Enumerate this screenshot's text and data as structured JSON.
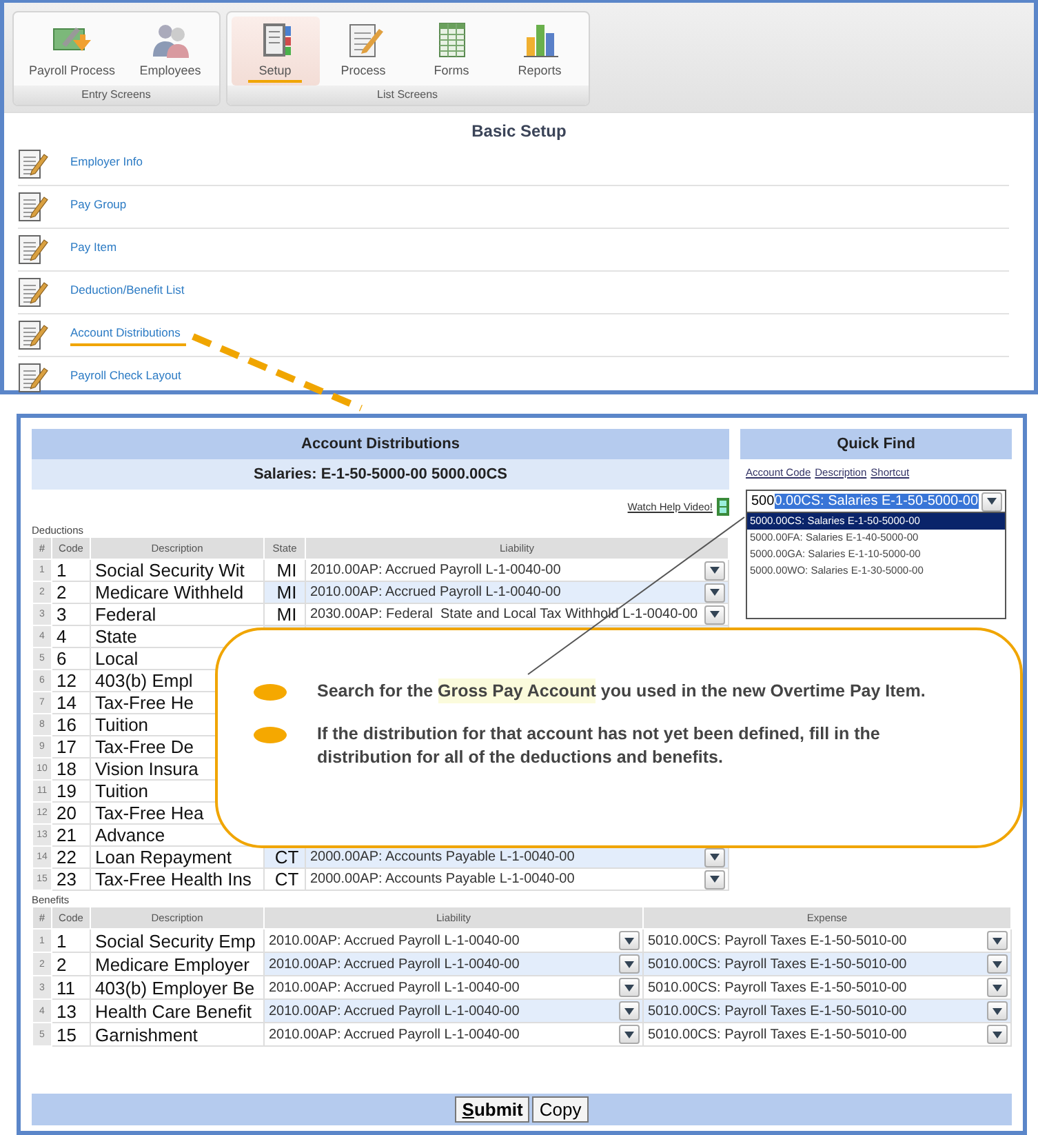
{
  "toolbar": {
    "groups": [
      {
        "label": "Entry Screens",
        "buttons": [
          {
            "label": "Payroll Process",
            "selected": false
          },
          {
            "label": "Employees",
            "selected": false
          }
        ]
      },
      {
        "label": "List Screens",
        "buttons": [
          {
            "label": "Setup",
            "selected": true
          },
          {
            "label": "Process",
            "selected": false
          },
          {
            "label": "Forms",
            "selected": false
          },
          {
            "label": "Reports",
            "selected": false
          }
        ]
      }
    ]
  },
  "basic_setup": {
    "title": "Basic Setup",
    "items": [
      {
        "label": "Employer Info",
        "selected": false
      },
      {
        "label": "Pay Group",
        "selected": false
      },
      {
        "label": "Pay Item",
        "selected": false
      },
      {
        "label": "Deduction/Benefit List",
        "selected": false
      },
      {
        "label": "Account Distributions",
        "selected": true
      },
      {
        "label": "Payroll Check Layout",
        "selected": false
      }
    ]
  },
  "account_distributions": {
    "title": "Account Distributions",
    "account": "Salaries: E-1-50-5000-00 5000.00CS",
    "help_link": "Watch Help Video!",
    "deductions": {
      "label": "Deductions",
      "columns": [
        "#",
        "Code",
        "Description",
        "State",
        "Liability"
      ],
      "rows": [
        {
          "num": "1",
          "code": "1",
          "description": "Social Security Wit",
          "state": "MI",
          "liability": "2010.00AP: Accrued Payroll L-1-0040-00"
        },
        {
          "num": "2",
          "code": "2",
          "description": "Medicare Withheld",
          "state": "MI",
          "liability": "2010.00AP: Accrued Payroll L-1-0040-00"
        },
        {
          "num": "3",
          "code": "3",
          "description": "Federal",
          "state": "MI",
          "liability": "2030.00AP: Federal  State and Local Tax Withhold L-1-0040-00"
        },
        {
          "num": "4",
          "code": "4",
          "description": "State"
        },
        {
          "num": "5",
          "code": "6",
          "description": "Local"
        },
        {
          "num": "6",
          "code": "12",
          "description": "403(b) Empl"
        },
        {
          "num": "7",
          "code": "14",
          "description": "Tax-Free He"
        },
        {
          "num": "8",
          "code": "16",
          "description": "Tuition"
        },
        {
          "num": "9",
          "code": "17",
          "description": "Tax-Free De"
        },
        {
          "num": "10",
          "code": "18",
          "description": "Vision Insura"
        },
        {
          "num": "11",
          "code": "19",
          "description": "Tuition"
        },
        {
          "num": "12",
          "code": "20",
          "description": "Tax-Free Hea"
        },
        {
          "num": "13",
          "code": "21",
          "description": "Advance"
        },
        {
          "num": "14",
          "code": "22",
          "description": "Loan Repayment",
          "state": "CT",
          "liability": "2000.00AP: Accounts Payable L-1-0040-00"
        },
        {
          "num": "15",
          "code": "23",
          "description": "Tax-Free Health Ins",
          "state": "CT",
          "liability": "2000.00AP: Accounts Payable L-1-0040-00"
        }
      ]
    },
    "benefits": {
      "label": "Benefits",
      "columns": [
        "#",
        "Code",
        "Description",
        "Liability",
        "Expense"
      ],
      "rows": [
        {
          "num": "1",
          "code": "1",
          "description": "Social Security Emp",
          "liability": "2010.00AP: Accrued Payroll L-1-0040-00",
          "expense": "5010.00CS: Payroll Taxes E-1-50-5010-00"
        },
        {
          "num": "2",
          "code": "2",
          "description": "Medicare Employer",
          "liability": "2010.00AP: Accrued Payroll L-1-0040-00",
          "expense": "5010.00CS: Payroll Taxes E-1-50-5010-00"
        },
        {
          "num": "3",
          "code": "11",
          "description": "403(b) Employer Be",
          "liability": "2010.00AP: Accrued Payroll L-1-0040-00",
          "expense": "5010.00CS: Payroll Taxes E-1-50-5010-00"
        },
        {
          "num": "4",
          "code": "13",
          "description": "Health Care Benefit",
          "liability": "2010.00AP: Accrued Payroll L-1-0040-00",
          "expense": "5010.00CS: Payroll Taxes E-1-50-5010-00"
        },
        {
          "num": "5",
          "code": "15",
          "description": "Garnishment",
          "liability": "2010.00AP: Accrued Payroll L-1-0040-00",
          "expense": "5010.00CS: Payroll Taxes E-1-50-5010-00"
        }
      ]
    },
    "buttons": [
      {
        "label": "Submit",
        "underline_first": true
      },
      {
        "label": "Copy",
        "underline_first": false
      }
    ]
  },
  "quick_find": {
    "title": "Quick Find",
    "search_by": [
      "Account Code",
      "Description",
      "Shortcut"
    ],
    "typed": "500",
    "autocomplete": "0.00CS: Salaries E-1-50-5000-00",
    "options": [
      {
        "label": "5000.00CS: Salaries E-1-50-5000-00",
        "selected": true
      },
      {
        "label": "5000.00FA: Salaries E-1-40-5000-00",
        "selected": false
      },
      {
        "label": "5000.00GA: Salaries E-1-10-5000-00",
        "selected": false
      },
      {
        "label": "5000.00WO: Salaries E-1-30-5000-00",
        "selected": false
      }
    ]
  },
  "callout": {
    "items": [
      {
        "before": "Search for the ",
        "highlight": "Gross Pay Account",
        "after": " you used in the new Overtime Pay Item."
      },
      {
        "before": "If the distribution for that account has not yet been defined, fill in the distribution for all of the deductions and benefits."
      }
    ]
  }
}
